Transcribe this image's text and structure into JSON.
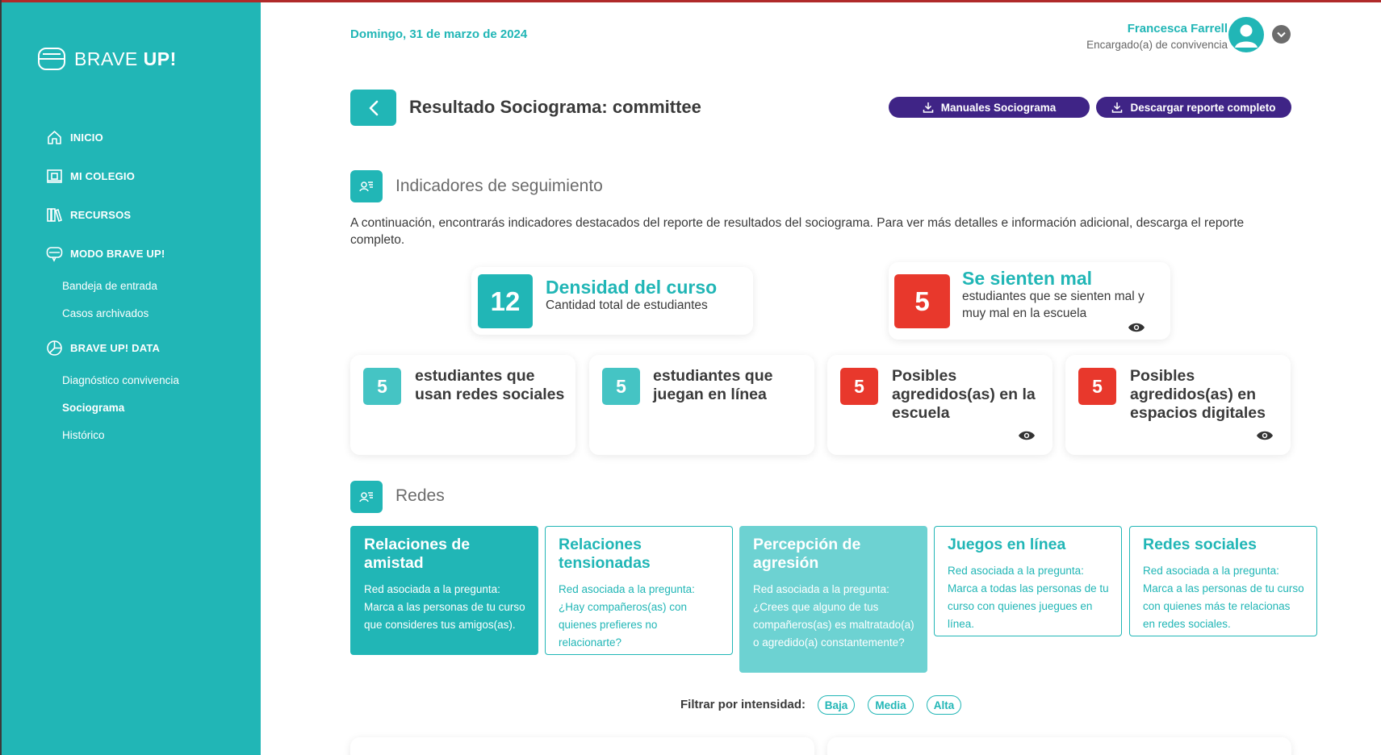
{
  "sidebar": {
    "logo_light": "BRAVE ",
    "logo_bold": "UP!",
    "nav": {
      "inicio": "INICIO",
      "mi_colegio": "MI COLEGIO",
      "recursos": "RECURSOS",
      "modo": "MODO BRAVE UP!",
      "bandeja": "Bandeja de entrada",
      "casos": "Casos archivados",
      "data": "BRAVE UP! DATA",
      "diagnostico": "Diagnóstico convivencia",
      "sociograma": "Sociograma",
      "historico": "Histórico"
    }
  },
  "header": {
    "date": "Domingo, 31 de marzo de 2024",
    "user_name": "Francesca Farrell",
    "user_role": "Encargado(a) de convivencia"
  },
  "title_bar": {
    "title": "Resultado Sociograma: committee",
    "manuales_label": "Manuales Sociograma",
    "descargar_label": "Descargar reporte completo"
  },
  "indicadores": {
    "heading": "Indicadores de seguimiento",
    "intro": "A continuación, encontrarás indicadores destacados del reporte de resultados del sociograma. Para ver más detalles e información adicional, descarga el reporte completo.",
    "densidad": {
      "value": "12",
      "title": "Densidad del curso",
      "subtitle": "Cantidad total de estudiantes"
    },
    "sienten_mal": {
      "value": "5",
      "title": "Se sienten mal",
      "subtitle": "estudiantes que se sienten mal y muy mal en la escuela"
    },
    "redes_sociales": {
      "value": "5",
      "text": "estudiantes que usan redes sociales"
    },
    "juegan": {
      "value": "5",
      "text": "estudiantes que juegan en línea"
    },
    "agredidos_escuela": {
      "value": "5",
      "text": "Posibles agredidos(as) en la escuela"
    },
    "agredidos_digital": {
      "value": "5",
      "text": "Posibles agredidos(as) en espacios digitales"
    }
  },
  "redes": {
    "heading": "Redes",
    "cards": [
      {
        "title": "Relaciones de amistad",
        "desc": "Red asociada a la pregunta: Marca a las personas de tu curso que consideres tus amigos(as)."
      },
      {
        "title": "Relaciones tensionadas",
        "desc": "Red asociada a la pregunta: ¿Hay compañeros(as) con quienes prefieres no relacionarte?"
      },
      {
        "title": "Percepción de agresión",
        "desc": "Red asociada a la pregunta: ¿Crees que alguno de tus compañeros(as) es maltratado(a) o agredido(a) constantemente?"
      },
      {
        "title": "Juegos en línea",
        "desc": "Red asociada a la pregunta: Marca a todas las personas de tu curso con quienes juegues en línea."
      },
      {
        "title": "Redes sociales",
        "desc": "Red asociada a la pregunta: Marca a las personas de tu curso con quienes más te relacionas en redes sociales."
      }
    ],
    "filter_label": "Filtrar por intensidad:",
    "filters": [
      "Baja",
      "Media",
      "Alta"
    ]
  },
  "colors": {
    "teal": "#21b6b6",
    "purple": "#3f2486",
    "red": "#e8382c"
  }
}
